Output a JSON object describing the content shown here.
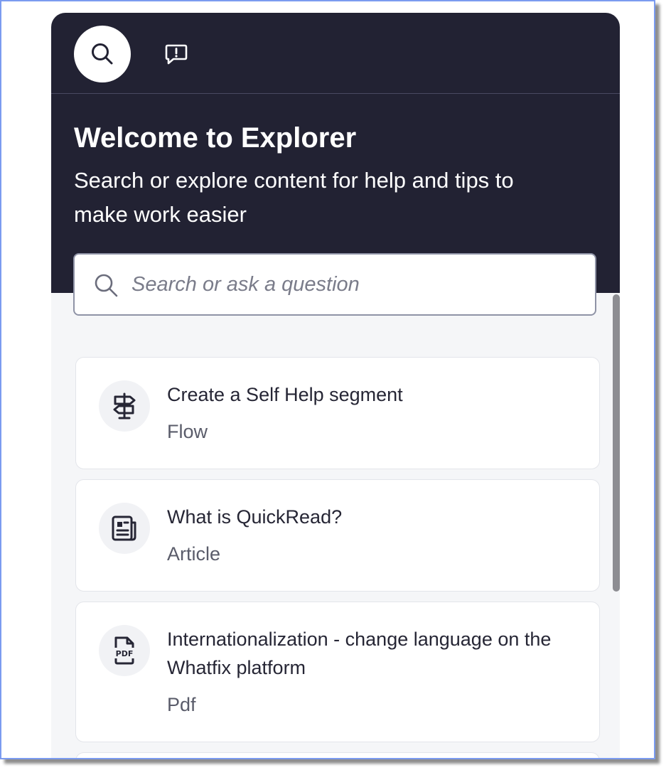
{
  "panel": {
    "title": "Welcome to Explorer",
    "subtitle": "Search or explore content for help and tips to make work easier"
  },
  "nav": {
    "tabs": [
      {
        "name": "search",
        "icon": "search-icon",
        "active": true
      },
      {
        "name": "feedback",
        "icon": "feedback-icon",
        "active": false
      }
    ]
  },
  "search": {
    "placeholder": "Search or ask a question",
    "value": ""
  },
  "results": [
    {
      "title": "Create a Self Help segment",
      "type": "Flow",
      "icon": "signpost-icon"
    },
    {
      "title": "What is QuickRead?",
      "type": "Article",
      "icon": "article-icon"
    },
    {
      "title": "Internationalization - change language on the Whatfix platform",
      "type": "Pdf",
      "icon": "pdf-icon"
    }
  ],
  "colors": {
    "header_bg": "#222233",
    "panel_bg": "#f5f6f8",
    "card_bg": "#ffffff",
    "text_primary": "#262635",
    "text_secondary": "#5a5c6a",
    "frame_border": "#7b9bf0"
  }
}
